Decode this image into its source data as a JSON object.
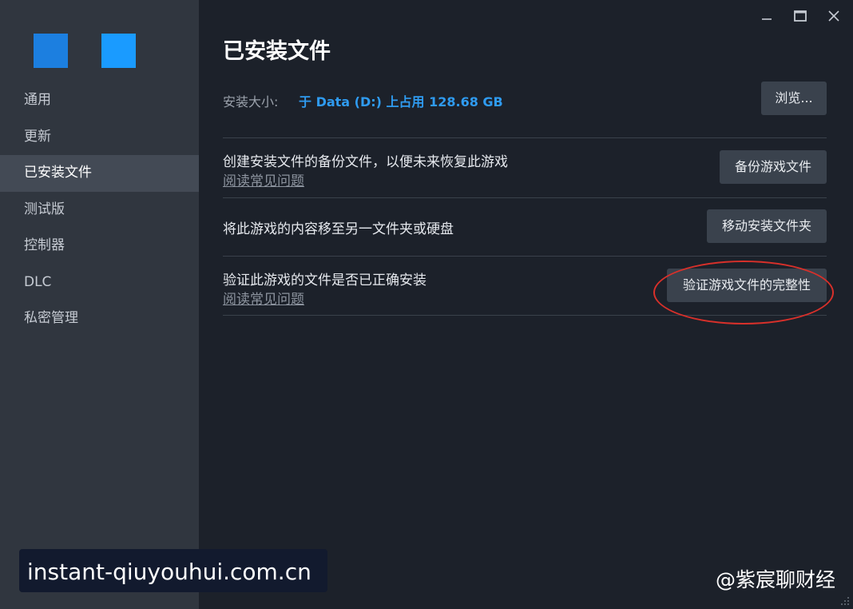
{
  "sidebar": {
    "items": [
      {
        "label": "通用"
      },
      {
        "label": "更新"
      },
      {
        "label": "已安装文件",
        "active": true
      },
      {
        "label": "测试版"
      },
      {
        "label": "控制器"
      },
      {
        "label": "DLC"
      },
      {
        "label": "私密管理"
      }
    ]
  },
  "window_controls": [
    "minimize-icon",
    "maximize-icon",
    "close-icon"
  ],
  "main": {
    "title": "已安装文件",
    "install_size_label": "安装大小:",
    "install_size_value": "于 Data (D:) 上占用 128.68 GB",
    "browse_button": "浏览...",
    "rows": [
      {
        "text": "创建安装文件的备份文件，以便未来恢复此游戏",
        "link": "阅读常见问题",
        "button": "备份游戏文件"
      },
      {
        "text": "将此游戏的内容移至另一文件夹或硬盘",
        "button": "移动安装文件夹"
      },
      {
        "text": "验证此游戏的文件是否已正确安装",
        "link": "阅读常见问题",
        "button": "验证游戏文件的完整性"
      }
    ]
  },
  "watermarks": {
    "left": "instant-qiuyouhui.com.cn",
    "right": "@紫宸聊财经"
  },
  "colors": {
    "accent": "#2f9bf0",
    "sidebar_bg": "#30363f",
    "main_bg": "#1c212a",
    "highlight": "#d8302a"
  }
}
